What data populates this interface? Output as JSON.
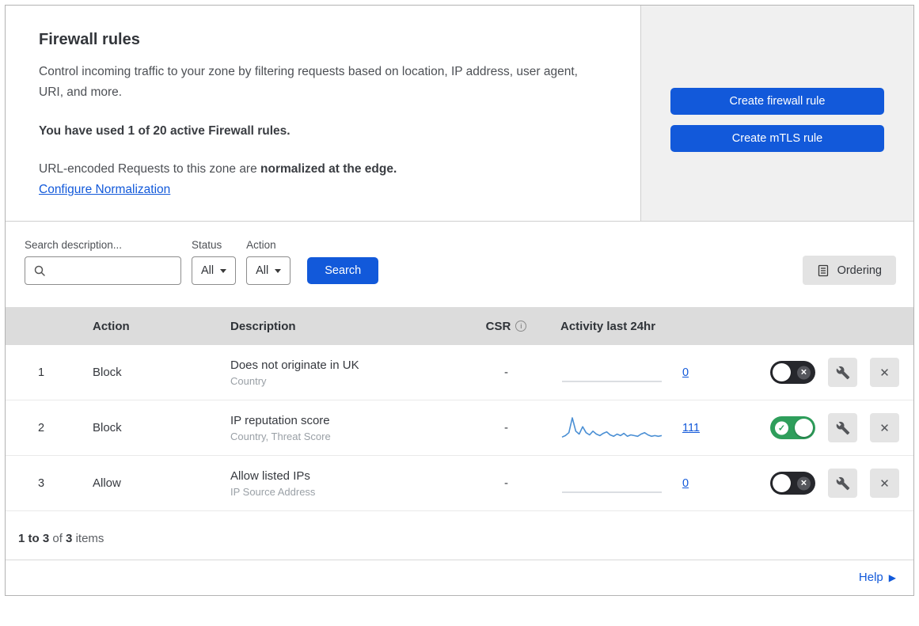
{
  "header": {
    "title": "Firewall rules",
    "description": "Control incoming traffic to your zone by filtering requests based on location, IP address, user agent, URI, and more.",
    "usage": "You have used 1 of 20 active Firewall rules.",
    "normalization_prefix": "URL-encoded Requests to this zone are ",
    "normalization_bold": "normalized at the edge.",
    "configure_link": "Configure Normalization",
    "create_firewall_button": "Create firewall rule",
    "create_mtls_button": "Create mTLS rule"
  },
  "filters": {
    "search_label": "Search description...",
    "status_label": "Status",
    "status_value": "All",
    "action_label": "Action",
    "action_value": "All",
    "search_button": "Search",
    "ordering_button": "Ordering"
  },
  "table": {
    "columns": {
      "action": "Action",
      "description": "Description",
      "csr": "CSR",
      "activity": "Activity last 24hr"
    },
    "rows": [
      {
        "num": "1",
        "action": "Block",
        "description": "Does not originate in UK",
        "fields": "Country",
        "csr": "-",
        "count": "0",
        "enabled": false,
        "spark": [
          0
        ]
      },
      {
        "num": "2",
        "action": "Block",
        "description": "IP reputation score",
        "fields": "Country, Threat Score",
        "csr": "-",
        "count": "111",
        "enabled": true,
        "spark": [
          4,
          6,
          10,
          30,
          12,
          8,
          18,
          10,
          7,
          12,
          8,
          6,
          9,
          11,
          7,
          5,
          8,
          6,
          9,
          5,
          7,
          6,
          5,
          8,
          10,
          7,
          5,
          6,
          5,
          6
        ]
      },
      {
        "num": "3",
        "action": "Allow",
        "description": "Allow listed IPs",
        "fields": "IP Source Address",
        "csr": "-",
        "count": "0",
        "enabled": false,
        "spark": [
          0
        ]
      }
    ]
  },
  "summary": {
    "range": "1 to 3",
    "of": "of",
    "total": "3",
    "items": "items"
  },
  "help": {
    "label": "Help"
  },
  "icons": {
    "check": "✓",
    "close": "✕",
    "info": "i",
    "help_arrow": "▶"
  },
  "colors": {
    "accent": "#1259da",
    "spark_line": "#4a8fd4",
    "spark_flat": "#cfd3d8",
    "toggle_on": "#2e9e5b",
    "toggle_off": "#26272c"
  }
}
